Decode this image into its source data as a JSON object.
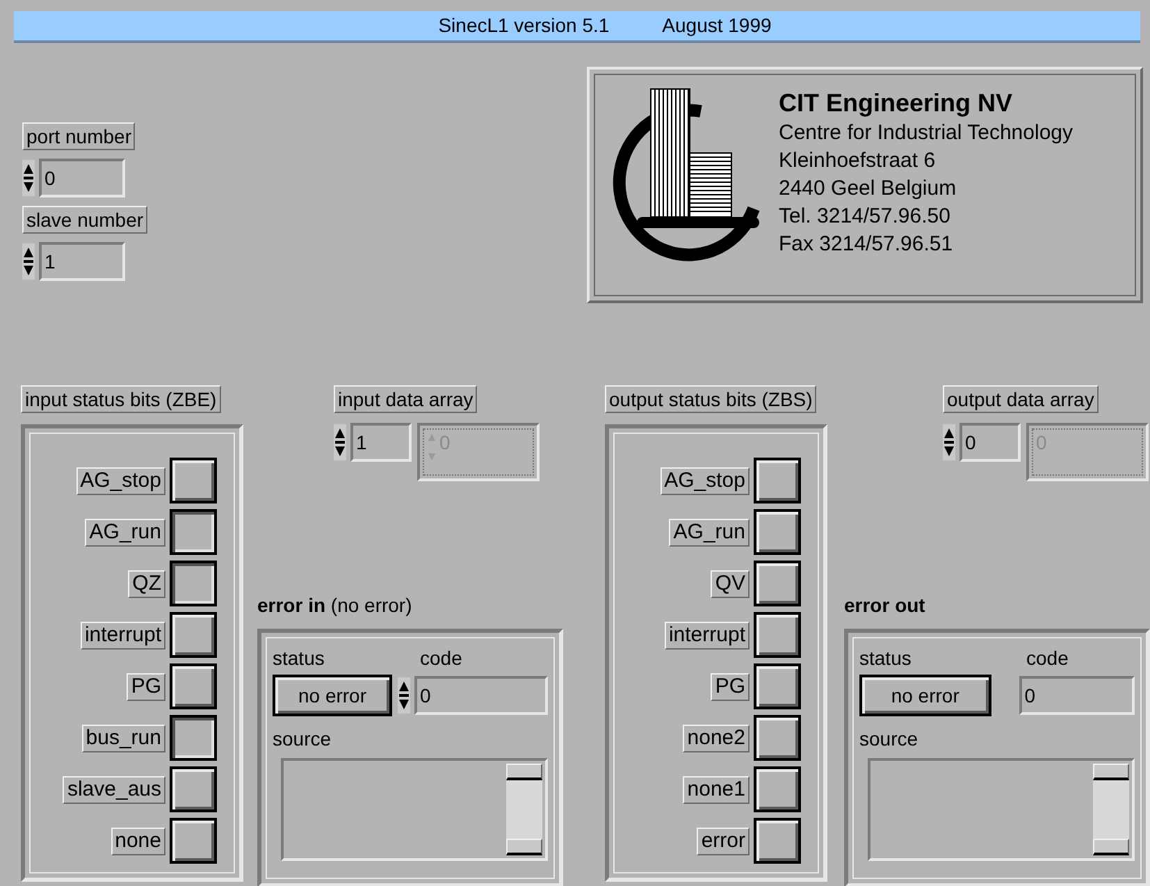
{
  "title_bar": {
    "title": "SinecL1 version 5.1",
    "date": "August 1999"
  },
  "port_number": {
    "label": "port number",
    "value": "0"
  },
  "slave_number": {
    "label": "slave number",
    "value": "1"
  },
  "company": {
    "name": "CIT Engineering NV",
    "lines": [
      "Centre for Industrial Technology",
      "Kleinhoefstraat 6",
      "2440 Geel Belgium",
      "Tel. 3214/57.96.50",
      "Fax 3214/57.96.51"
    ]
  },
  "input_status_bits": {
    "label": "input status bits (ZBE)",
    "bits": [
      {
        "label": "AG_stop",
        "on": false
      },
      {
        "label": "AG_run",
        "on": true
      },
      {
        "label": "QZ",
        "on": true
      },
      {
        "label": "interrupt",
        "on": false
      },
      {
        "label": "PG",
        "on": false
      },
      {
        "label": "bus_run",
        "on": true
      },
      {
        "label": "slave_aus",
        "on": false
      },
      {
        "label": "none",
        "on": false
      }
    ]
  },
  "input_data_array": {
    "label": "input data array",
    "index": "1",
    "element": "0"
  },
  "error_in": {
    "kind": "control",
    "title": "error in",
    "hint": "(no error)",
    "status_label": "status",
    "status": "no error",
    "code_label": "code",
    "code": "0",
    "source_label": "source"
  },
  "output_status_bits": {
    "label": "output status bits (ZBS)",
    "bits": [
      {
        "label": "AG_stop",
        "on": false
      },
      {
        "label": "AG_run",
        "on": false
      },
      {
        "label": "QV",
        "on": false
      },
      {
        "label": "interrupt",
        "on": false
      },
      {
        "label": "PG",
        "on": false
      },
      {
        "label": "none2",
        "on": false
      },
      {
        "label": "none1",
        "on": false
      },
      {
        "label": "error",
        "on": false
      }
    ]
  },
  "output_data_array": {
    "label": "output data array",
    "index": "0",
    "element": "0"
  },
  "error_out": {
    "kind": "indicator",
    "title": "error out",
    "status_label": "status",
    "status": "no error",
    "code_label": "code",
    "code": "0",
    "source_label": "source"
  }
}
